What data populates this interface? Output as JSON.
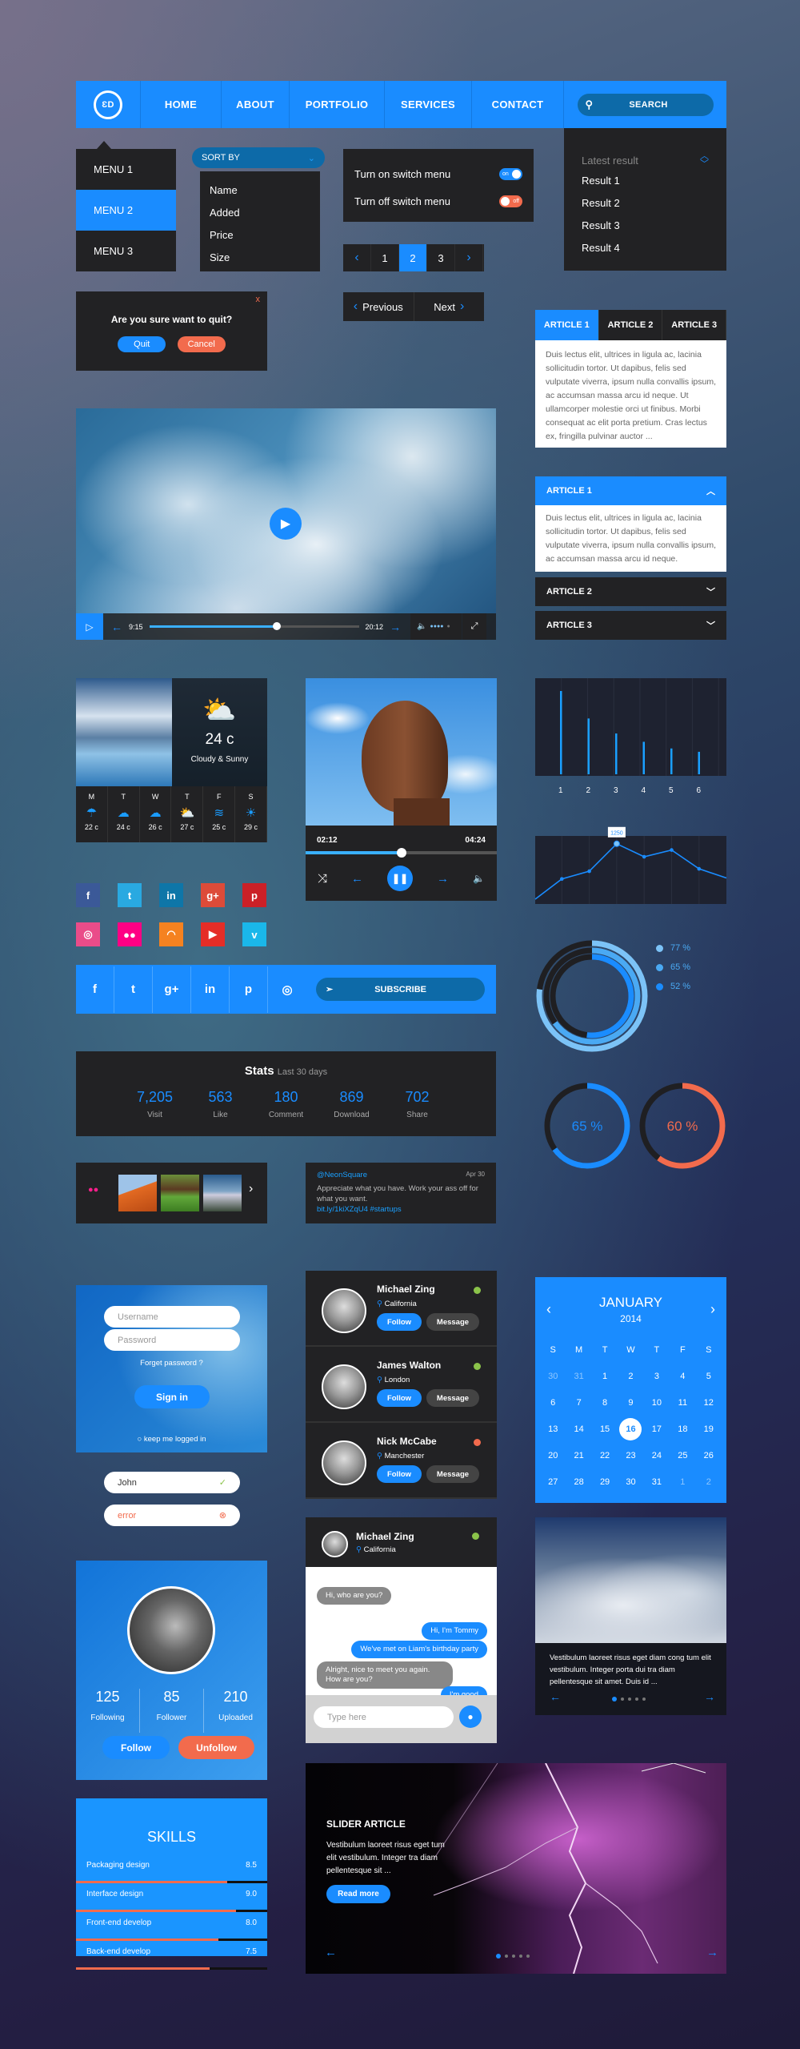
{
  "nav": {
    "logo_icon": "logo-icon",
    "items": [
      "HOME",
      "ABOUT",
      "PORTFOLIO",
      "SERVICES",
      "CONTACT"
    ],
    "search_placeholder": "SEARCH"
  },
  "menu": {
    "items": [
      "MENU 1",
      "MENU 2",
      "MENU 3"
    ],
    "active": 1
  },
  "sort": {
    "label": "SORT BY",
    "options": [
      "Name",
      "Added",
      "Price",
      "Size"
    ]
  },
  "switches": [
    {
      "label": "Turn on switch menu",
      "state": "on"
    },
    {
      "label": "Turn off switch menu",
      "state": "off"
    }
  ],
  "results": {
    "title": "Latest result",
    "items": [
      "Result 1",
      "Result 2",
      "Result 3",
      "Result 4"
    ]
  },
  "pagination": {
    "pages": [
      "1",
      "2",
      "3"
    ],
    "current": 1
  },
  "prevnext": {
    "prev": "Previous",
    "next": "Next"
  },
  "dialog": {
    "question": "Are you sure want to quit?",
    "quit": "Quit",
    "cancel": "Cancel",
    "close": "x"
  },
  "tabs": {
    "labels": [
      "ARTICLE 1",
      "ARTICLE 2",
      "ARTICLE 3"
    ],
    "active": 0,
    "body": "Duis lectus elit, ultrices in ligula ac, lacinia sollicitudin tortor. Ut dapibus, felis sed vulputate viverra, ipsum nulla convallis ipsum, ac accumsan massa arcu id neque. Ut ullamcorper molestie orci ut finibus. Morbi consequat ac elit porta pretium. Cras lectus ex, fringilla pulvinar auctor ..."
  },
  "accordion": {
    "items": [
      {
        "label": "ARTICLE 1",
        "open": true,
        "body": "Duis lectus elit, ultrices in ligula ac, lacinia sollicitudin tortor. Ut dapibus, felis sed vulputate viverra, ipsum nulla convallis ipsum, ac accumsan massa arcu id neque."
      },
      {
        "label": "ARTICLE 2",
        "open": false
      },
      {
        "label": "ARTICLE 3",
        "open": false
      }
    ]
  },
  "video": {
    "current": "9:15",
    "total": "20:12",
    "progress": 0.61,
    "volume_level": 0.8
  },
  "weather": {
    "temp": "24 c",
    "condition": "Cloudy & Sunny",
    "forecast": [
      {
        "day": "M",
        "icon": "rain-cloud",
        "glyph": "☂",
        "temp": "22 c"
      },
      {
        "day": "T",
        "icon": "drizzle-cloud",
        "glyph": "☁",
        "temp": "24 c"
      },
      {
        "day": "W",
        "icon": "cloud",
        "glyph": "☁",
        "temp": "26 c"
      },
      {
        "day": "T",
        "icon": "partly-cloudy",
        "glyph": "⛅",
        "temp": "27 c"
      },
      {
        "day": "F",
        "icon": "wind",
        "glyph": "≋",
        "temp": "25 c"
      },
      {
        "day": "S",
        "icon": "sun",
        "glyph": "☀",
        "temp": "29 c"
      }
    ]
  },
  "music": {
    "current": "02:12",
    "total": "04:24",
    "progress": 0.5
  },
  "bar_chart": {
    "labels": [
      "1",
      "2",
      "3",
      "4",
      "5",
      "6"
    ],
    "values": [
      100,
      67,
      49,
      39,
      31,
      27
    ],
    "color": "#1aa0ff"
  },
  "line_chart": {
    "values": [
      100,
      520,
      680,
      1250,
      980,
      1120,
      730,
      540
    ],
    "highlight_index": 3,
    "highlight_label": "1250",
    "color": "#1a8cff"
  },
  "social_icons": [
    {
      "name": "facebook",
      "glyph": "f",
      "color": "#3b5998"
    },
    {
      "name": "twitter",
      "glyph": "t",
      "color": "#29a9e1"
    },
    {
      "name": "linkedin",
      "glyph": "in",
      "color": "#0e76a8"
    },
    {
      "name": "google-plus",
      "glyph": "g+",
      "color": "#dd4b39"
    },
    {
      "name": "pinterest",
      "glyph": "p",
      "color": "#cb2027"
    },
    {
      "name": "dribbble",
      "glyph": "◎",
      "color": "#ea4c89"
    },
    {
      "name": "flickr",
      "glyph": "●●",
      "color": "#ff0084"
    },
    {
      "name": "rss",
      "glyph": "◠",
      "color": "#f58220"
    },
    {
      "name": "youtube",
      "glyph": "▶",
      "color": "#e52d27"
    },
    {
      "name": "vimeo",
      "glyph": "v",
      "color": "#1ab7ea"
    }
  ],
  "share_bar": {
    "icons": [
      {
        "name": "facebook",
        "glyph": "f"
      },
      {
        "name": "twitter",
        "glyph": "t"
      },
      {
        "name": "google-plus",
        "glyph": "g+"
      },
      {
        "name": "linkedin",
        "glyph": "in"
      },
      {
        "name": "pinterest",
        "glyph": "p"
      },
      {
        "name": "dribbble",
        "glyph": "◎"
      }
    ],
    "subscribe": "SUBSCRIBE"
  },
  "rings": [
    {
      "value": 77,
      "label": "77 %",
      "color": "#7cc3f7"
    },
    {
      "value": 65,
      "label": "65 %",
      "color": "#4aa9f3"
    },
    {
      "value": 52,
      "label": "52 %",
      "color": "#1a8cff"
    }
  ],
  "stats": {
    "title": "Stats",
    "subtitle": "Last 30 days",
    "items": [
      {
        "value": "7,205",
        "label": "Visit"
      },
      {
        "value": "563",
        "label": "Like"
      },
      {
        "value": "180",
        "label": "Comment"
      },
      {
        "value": "869",
        "label": "Download"
      },
      {
        "value": "702",
        "label": "Share"
      }
    ]
  },
  "gauges": [
    {
      "value": 65,
      "label": "65 %",
      "color": "#1a8cff"
    },
    {
      "value": 60,
      "label": "60 %",
      "color": "#f26b4d"
    }
  ],
  "gallery": {
    "icon": "flickr-icon",
    "thumbs": [
      "desert",
      "horse",
      "mountains"
    ]
  },
  "tweet": {
    "handle": "@NeonSquare",
    "date": "Apr 30",
    "text": "Appreciate what you have. Work your ass off for what you want.",
    "link": "bit.ly/1kiXZqU4 #startups"
  },
  "login": {
    "username_placeholder": "Username",
    "password_placeholder": "Password",
    "forgot": "Forget password ?",
    "signin": "Sign in",
    "remember": "keep me logged in"
  },
  "inputs": {
    "valid_value": "John",
    "error_value": "error"
  },
  "people": {
    "follow": "Follow",
    "message": "Message",
    "items": [
      {
        "name": "Michael Zing",
        "location": "California",
        "status": "online",
        "status_color": "#8bc34a"
      },
      {
        "name": "James Walton",
        "location": "London",
        "status": "online",
        "status_color": "#8bc34a"
      },
      {
        "name": "Nick McCabe",
        "location": "Manchester",
        "status": "busy",
        "status_color": "#f26b4d"
      }
    ]
  },
  "calendar": {
    "month": "JANUARY",
    "year": "2014",
    "weekdays": [
      "S",
      "M",
      "T",
      "W",
      "T",
      "F",
      "S"
    ],
    "selected": "16",
    "weeks": [
      [
        {
          "d": "30",
          "muted": true
        },
        {
          "d": "31",
          "muted": true
        },
        "1",
        "2",
        "3",
        "4",
        "5"
      ],
      [
        "6",
        "7",
        "8",
        "9",
        "10",
        "11",
        "12"
      ],
      [
        "13",
        "14",
        "15",
        "16",
        "17",
        "18",
        "19"
      ],
      [
        "20",
        "21",
        "22",
        "23",
        "24",
        "25",
        "26"
      ],
      [
        "27",
        "28",
        "29",
        "30",
        "31",
        {
          "d": "1",
          "muted": true
        },
        {
          "d": "2",
          "muted": true
        }
      ]
    ]
  },
  "profile": {
    "stats": [
      {
        "value": "125",
        "label": "Following"
      },
      {
        "value": "85",
        "label": "Follower"
      },
      {
        "value": "210",
        "label": "Uploaded"
      }
    ],
    "follow": "Follow",
    "unfollow": "Unfollow"
  },
  "chat": {
    "name": "Michael Zing",
    "location": "California",
    "messages": [
      {
        "from": "them",
        "text": "Hi, who are you?"
      },
      {
        "from": "me",
        "text": "Hi, I'm Tommy"
      },
      {
        "from": "me",
        "text": "We've met on Liam's birthday party"
      },
      {
        "from": "them",
        "text": "Alright, nice to meet you again. How are you?"
      },
      {
        "from": "me",
        "text": "I'm good"
      }
    ],
    "placeholder": "Type here"
  },
  "cloud_slider": {
    "text": "Vestibulum laoreet risus eget diam cong tum elit vestibulum. Integer porta dui tra diam pellentesque sit amet. Duis id ...",
    "slides": 5,
    "active": 0
  },
  "skills": {
    "title": "SKILLS",
    "items": [
      {
        "label": "Packaging design",
        "value": "8.5"
      },
      {
        "label": "Interface design",
        "value": "9.0"
      },
      {
        "label": "Front-end develop",
        "value": "8.0"
      },
      {
        "label": "Back-end develop",
        "value": "7.5"
      }
    ],
    "bar_color": "#f26b4d"
  },
  "slider": {
    "title": "SLIDER ARTICLE",
    "text": "Vestibulum laoreet risus eget tum elit vestibulum. Integer tra diam pellentesque sit ...",
    "button": "Read more",
    "slides": 5,
    "active": 0
  },
  "colors": {
    "accent": "#1a8cff",
    "danger": "#f26b4d",
    "panel": "#222224",
    "success": "#8bc34a"
  }
}
